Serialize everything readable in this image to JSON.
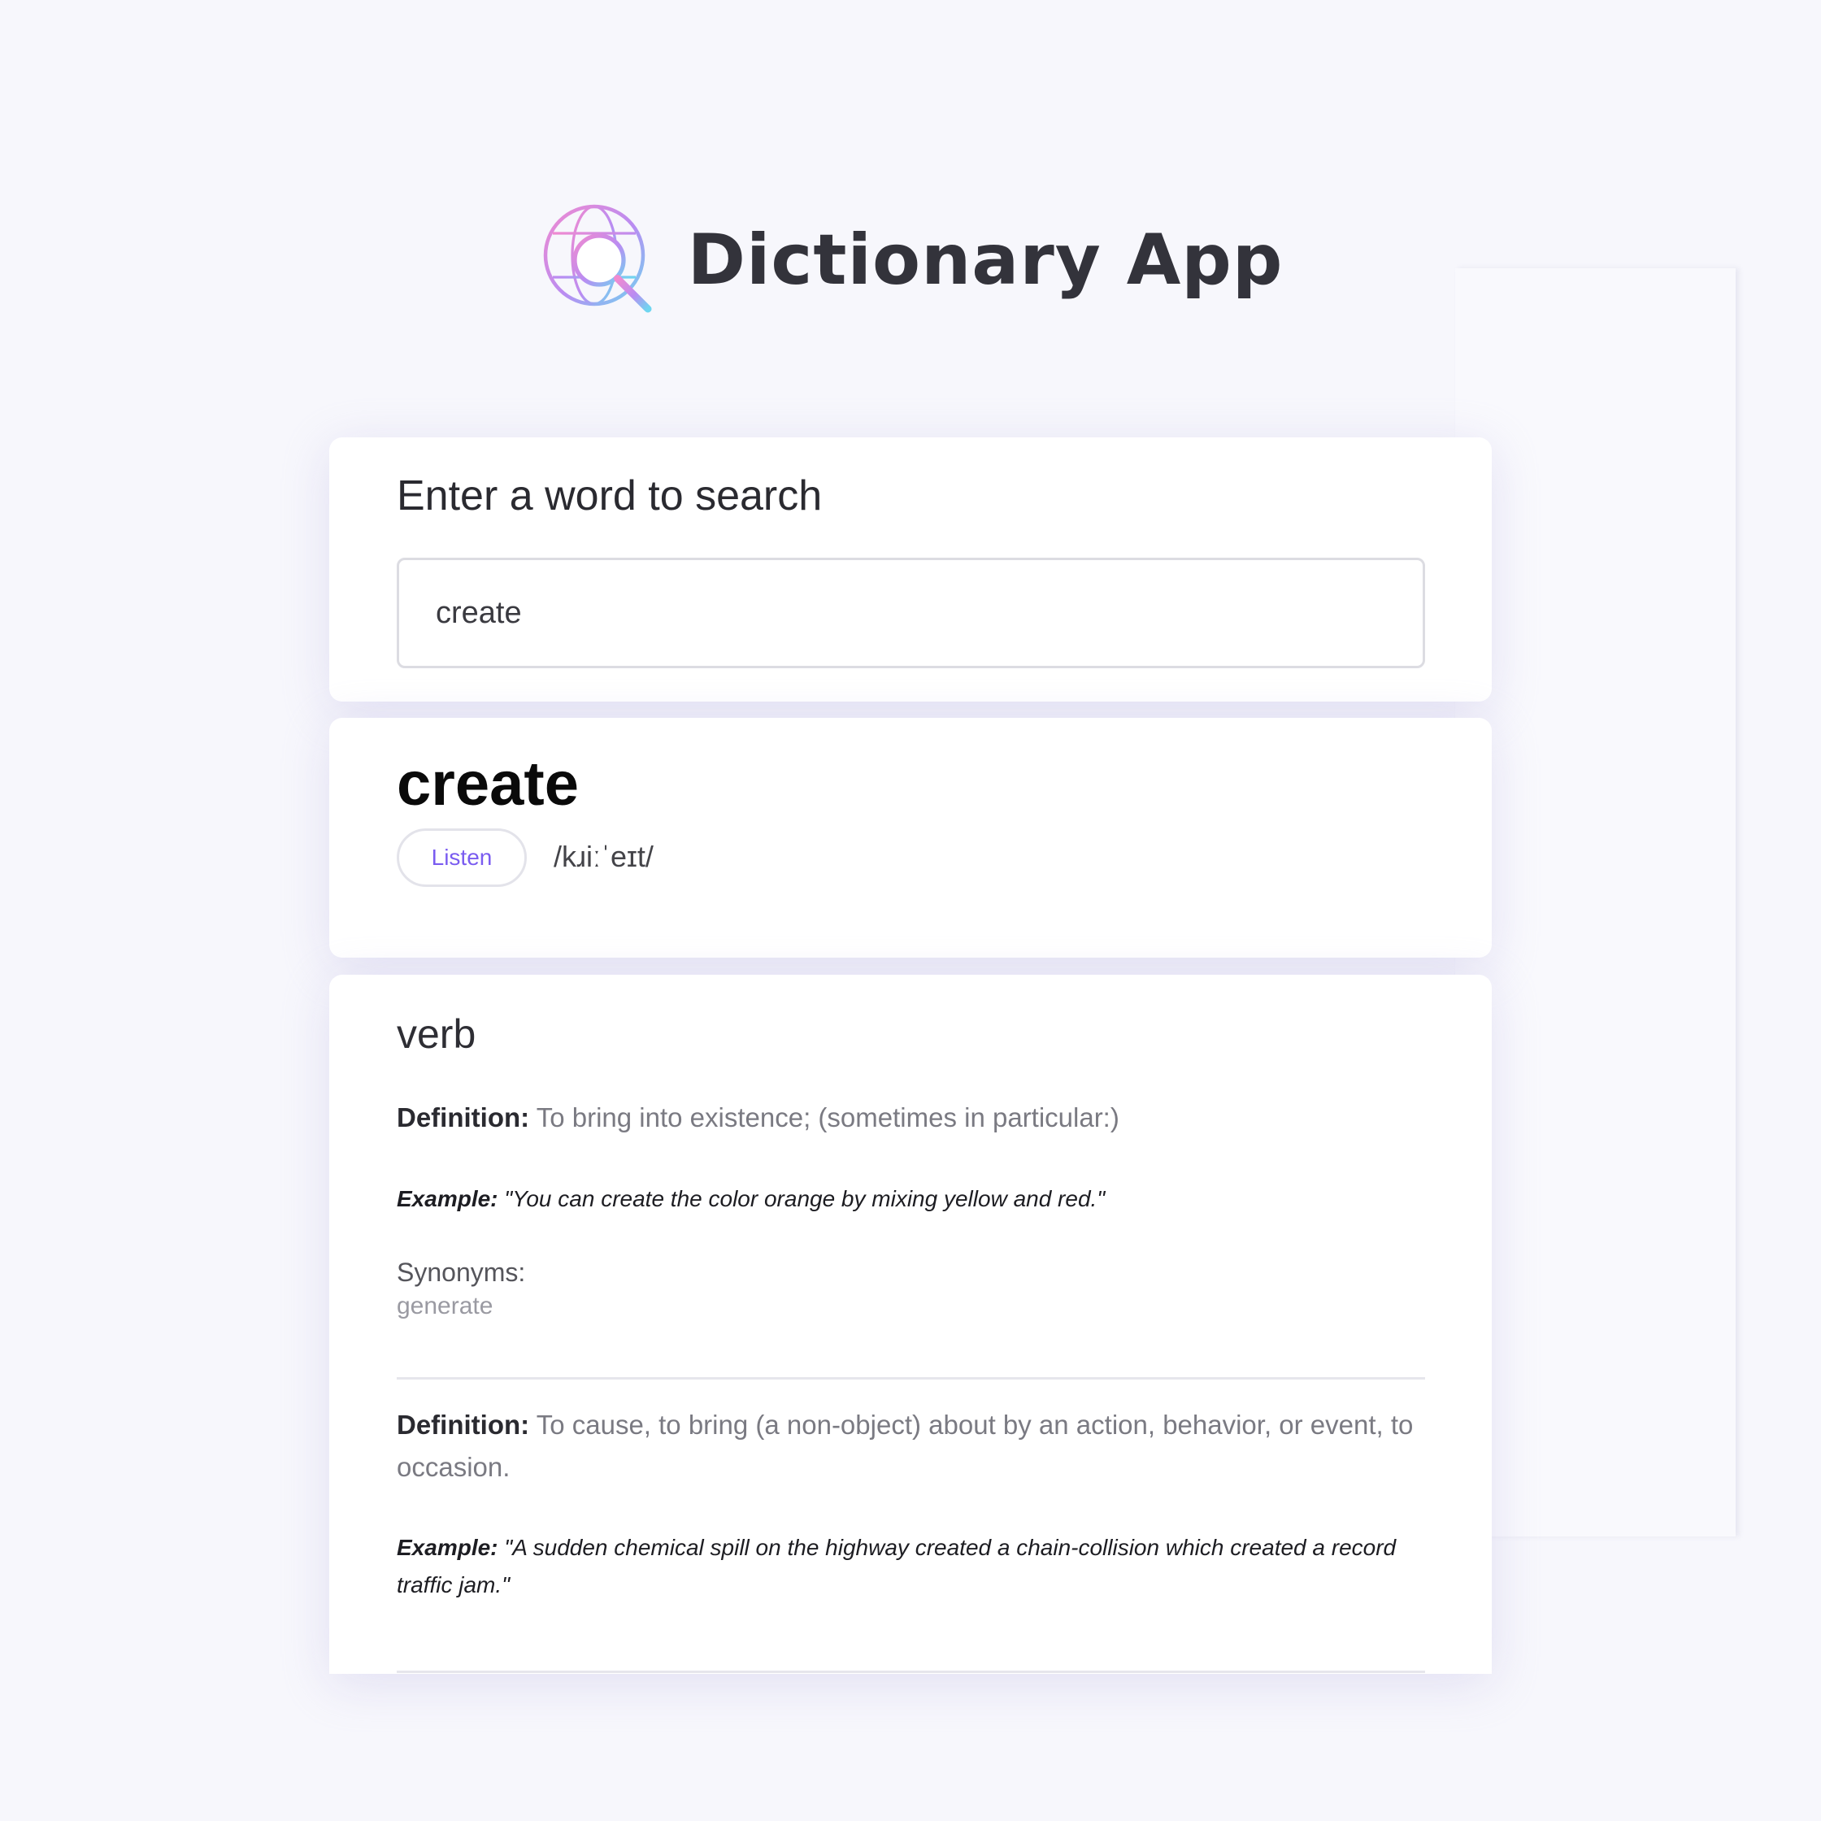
{
  "app": {
    "title": "Dictionary App",
    "logo_icon": "globe-search-icon"
  },
  "search": {
    "label": "Enter a word to search",
    "value": "create"
  },
  "word": {
    "text": "create",
    "listen_label": "Listen",
    "phonetic": "/kɹiːˈeɪt/"
  },
  "meanings": {
    "part_of_speech": "verb",
    "definitions": [
      {
        "definition_label": "Definition:",
        "definition": "To bring into existence; (sometimes in particular:)",
        "example_label": "Example:",
        "example": "\"You can create the color orange by mixing yellow and red.\"",
        "synonyms_label": "Synonyms:",
        "synonyms": [
          "generate"
        ]
      },
      {
        "definition_label": "Definition:",
        "definition": "To cause, to bring (a non-object) about by an action, behavior, or event, to occasion.",
        "example_label": "Example:",
        "example": "\"A sudden chemical spill on the highway created a chain-collision which created a record traffic jam.\""
      }
    ]
  },
  "colors": {
    "background": "#f7f7fc",
    "card": "#ffffff",
    "accent": "#7a5cf0"
  }
}
